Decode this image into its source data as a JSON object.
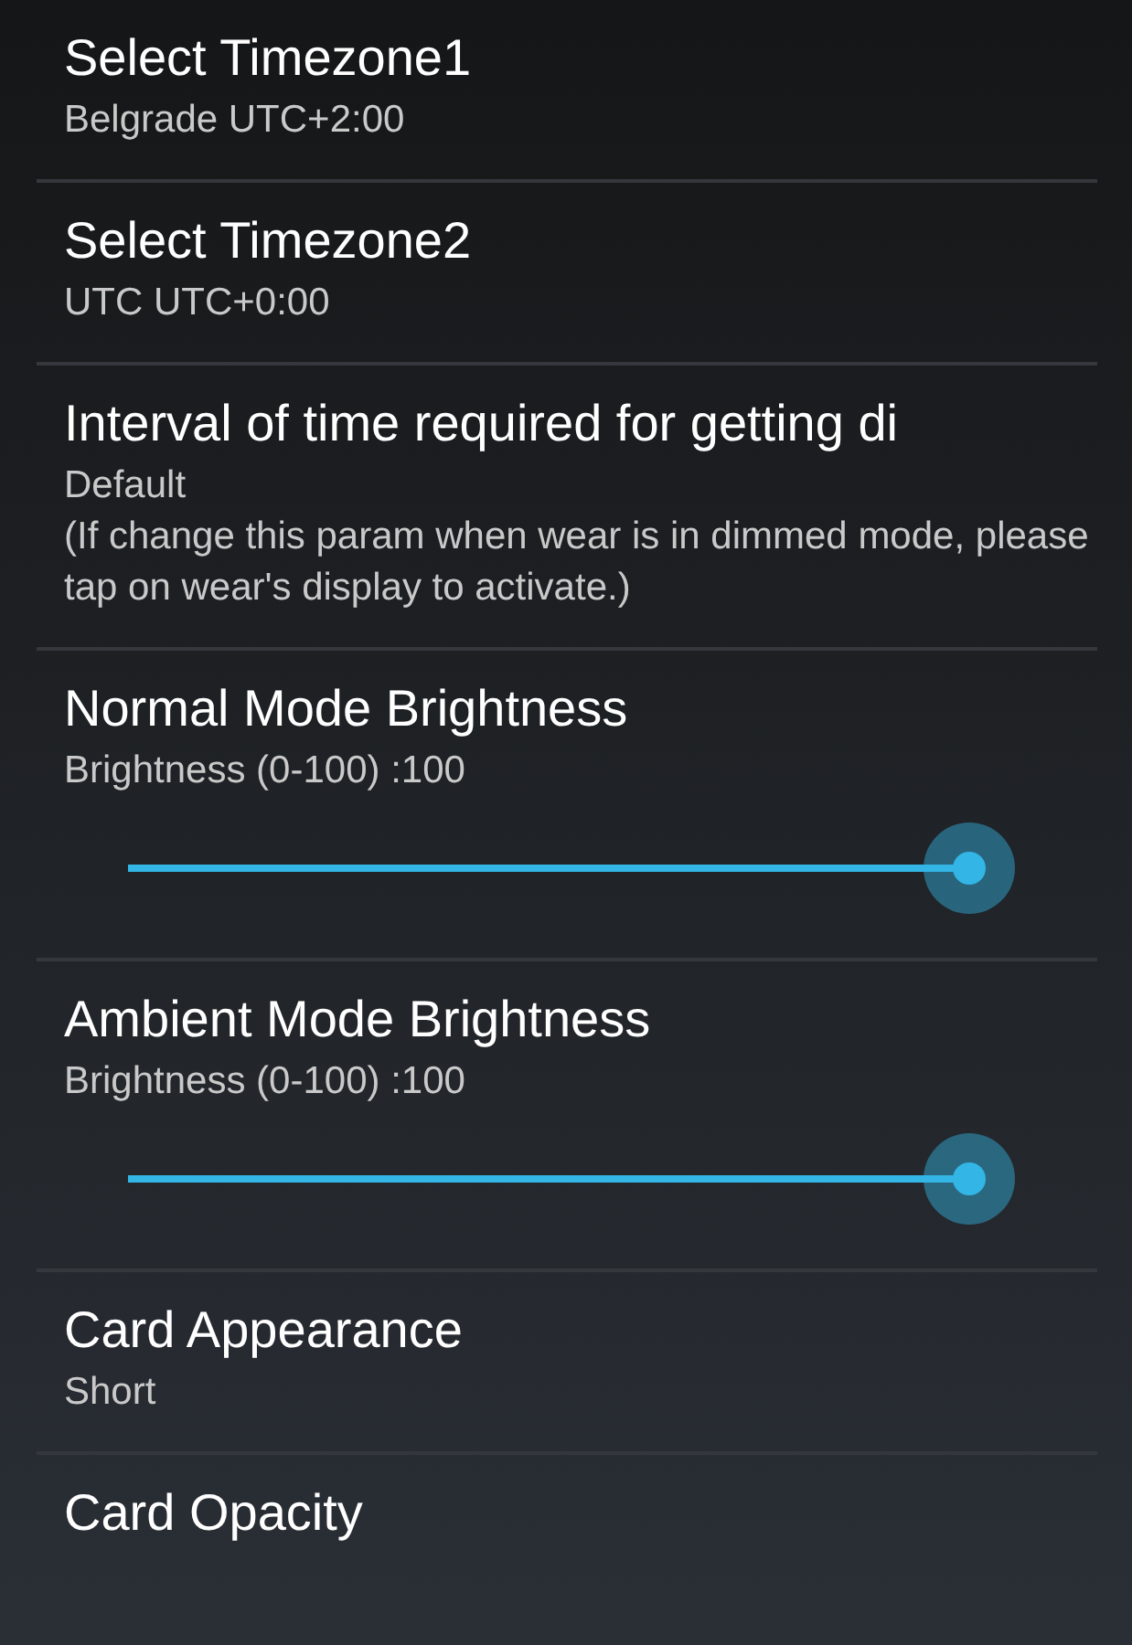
{
  "settings": [
    {
      "kind": "text",
      "title": "Select Timezone1",
      "summary": "Belgrade UTC+2:00"
    },
    {
      "kind": "text",
      "title": "Select Timezone2",
      "summary": "UTC UTC+0:00"
    },
    {
      "kind": "text",
      "title": "Interval of time required for getting di",
      "summary": "Default\n(If change this param when wear is in dimmed mode, please tap on wear's display to activate.)"
    },
    {
      "kind": "slider",
      "title": "Normal Mode Brightness",
      "summary": "Brightness (0-100) :100",
      "level": 1
    },
    {
      "kind": "slider",
      "title": "Ambient Mode Brightness",
      "summary": "Brightness (0-100) :100",
      "level": 1
    },
    {
      "kind": "text",
      "title": "Card Appearance",
      "summary": "Short"
    },
    {
      "kind": "text",
      "title": "Card Opacity"
    }
  ]
}
